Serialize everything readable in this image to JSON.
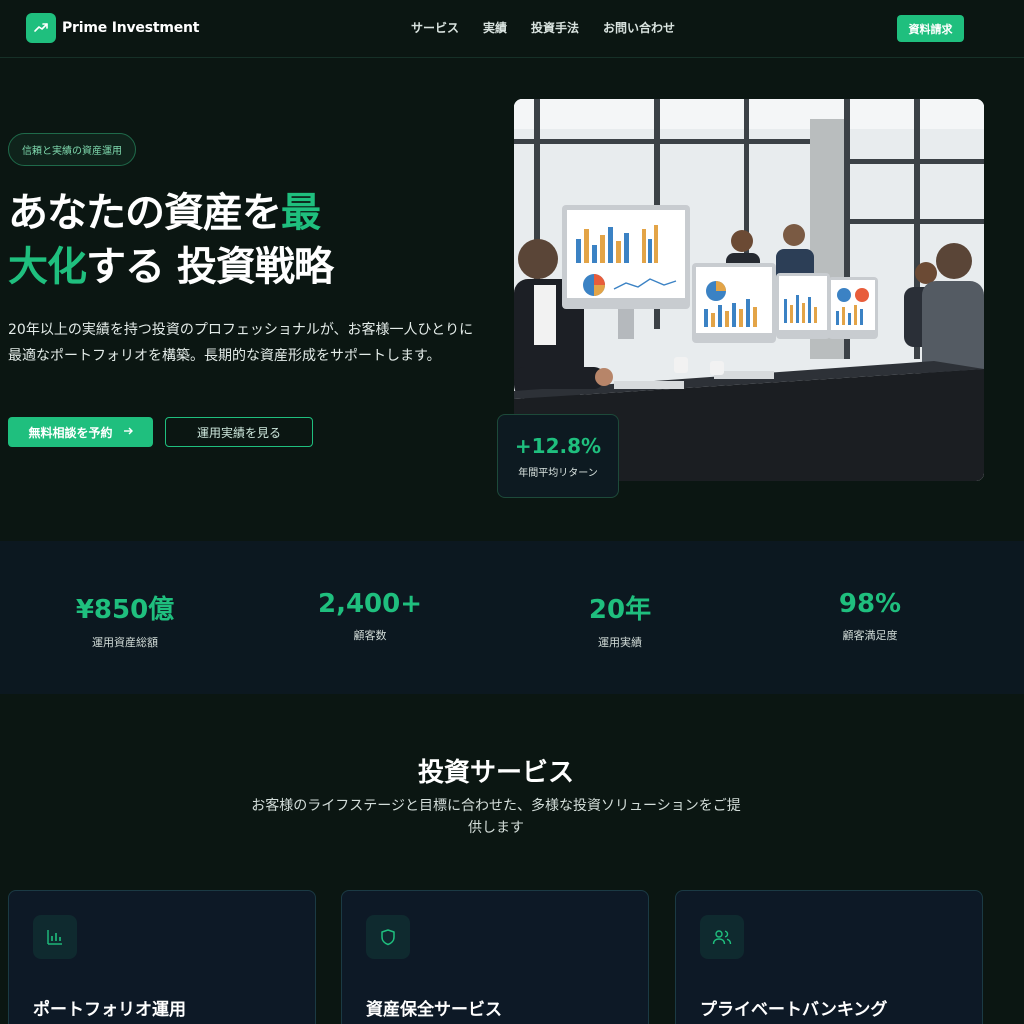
{
  "header": {
    "brand": "Prime Investment",
    "nav": [
      "サービス",
      "実績",
      "投資手法",
      "お問い合わせ"
    ],
    "cta": "資料請求"
  },
  "hero": {
    "badge": "信頼と実績の資産運用",
    "title_part1": "あなたの資産を",
    "title_accent1": "最",
    "title_accent2": "大化",
    "title_part2": "する 投資戦略",
    "description": "20年以上の実績を持つ投資のプロフェッショナルが、お客様一人ひとりに最適なポートフォリオを構築。長期的な資産形成をサポートします。",
    "primary_button": "無料相談を予約",
    "secondary_button": "運用実績を見る",
    "return_value": "+12.8%",
    "return_label": "年間平均リターン"
  },
  "stats": [
    {
      "value": "¥850億",
      "label": "運用資産総額"
    },
    {
      "value": "2,400+",
      "label": "顧客数"
    },
    {
      "value": "20年",
      "label": "運用実績"
    },
    {
      "value": "98%",
      "label": "顧客満足度"
    }
  ],
  "services": {
    "title": "投資サービス",
    "subtitle": "お客様のライフステージと目標に合わせた、多様な投資ソリューションをご提供します",
    "cards": [
      {
        "title": "ポートフォリオ運用",
        "icon": "bar-chart-icon"
      },
      {
        "title": "資産保全サービス",
        "icon": "shield-icon"
      },
      {
        "title": "プライベートバンキング",
        "icon": "users-icon"
      }
    ]
  },
  "colors": {
    "accent": "#1fbf7e",
    "background": "#0b1612",
    "stats_background": "#0c1820"
  }
}
